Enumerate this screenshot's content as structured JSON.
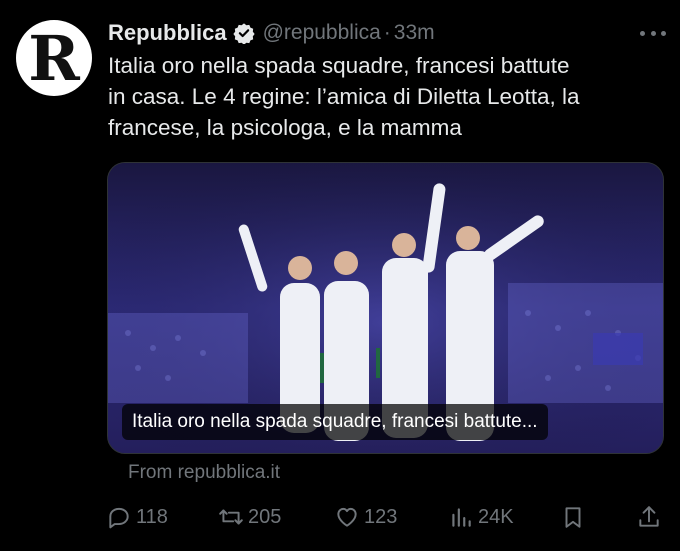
{
  "tweet": {
    "avatar_letter": "R",
    "display_name": "Repubblica",
    "handle": "@repubblica",
    "separator": "·",
    "time": "33m",
    "text_lines": [
      "Italia oro nella spada squadre, francesi battute",
      "in casa. Le 4 regine: l’amica di Diletta Leotta, la",
      "francese, la psicologa, e la mamma"
    ]
  },
  "card": {
    "caption": "Italia oro nella spada squadre, francesi battute...",
    "source": "From repubblica.it"
  },
  "actions": {
    "replies": "118",
    "reposts": "205",
    "likes": "123",
    "views": "24K"
  },
  "colors": {
    "background": "#000000",
    "text": "#e7e9ea",
    "muted": "#71767b",
    "verified": "#1d9bf0"
  },
  "icons": [
    "more-icon",
    "verified-badge-icon",
    "reply-icon",
    "repost-icon",
    "like-icon",
    "views-icon",
    "bookmark-icon",
    "share-icon"
  ]
}
